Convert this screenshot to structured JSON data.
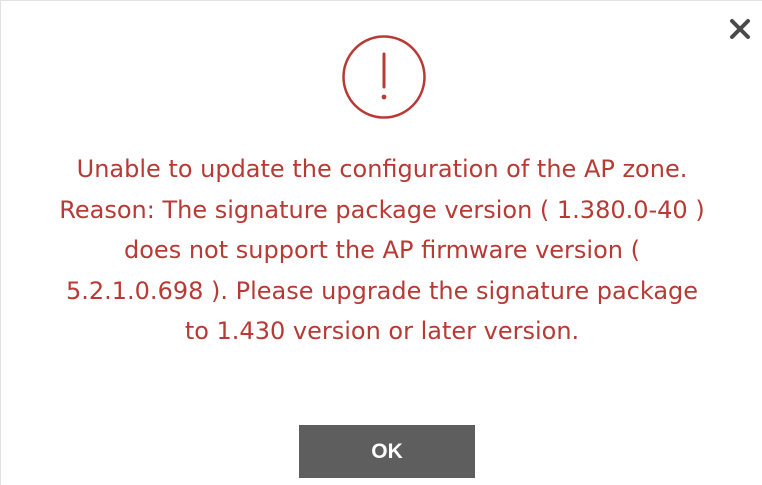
{
  "dialog": {
    "message_lines": [
      "Unable to update the configuration of the AP zone.",
      "Reason: The signature package version ( 1.380.0-40 )",
      "does not support the AP firmware version (",
      "5.2.1.0.698 ). Please upgrade the signature package",
      "to 1.430 version or later version."
    ],
    "ok_label": "OK",
    "icons": {
      "alert": "exclamation-circle-icon",
      "close": "close-icon"
    },
    "colors": {
      "message": "#b73a35",
      "alert_icon": "#b73a35",
      "ok_button_bg": "#5e5e5e",
      "ok_button_text": "#ffffff",
      "close_icon": "#4a4a4a"
    }
  }
}
